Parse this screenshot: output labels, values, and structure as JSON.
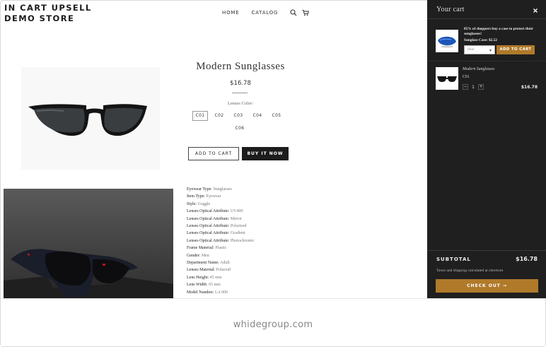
{
  "store": {
    "logo_line1": "IN CART UPSELL",
    "logo_line2": "DEMO STORE"
  },
  "nav": {
    "home": "HOME",
    "catalog": "CATALOG",
    "icons": [
      "search-icon",
      "cart-icon"
    ]
  },
  "product": {
    "title": "Modern Sunglasses",
    "price": "$16.78",
    "color_label": "Lenses Color:",
    "variants": [
      "C01",
      "C02",
      "C03",
      "C04",
      "C05",
      "C06"
    ],
    "selected_variant": "C01",
    "add_to_cart": "ADD TO CART",
    "buy_now": "BUY IT NOW"
  },
  "specs": [
    {
      "label": "Eyewear Type:",
      "value": "Sunglasses"
    },
    {
      "label": "Item Type:",
      "value": "Eyewear"
    },
    {
      "label": "Style:",
      "value": "Goggle"
    },
    {
      "label": "Lenses Optical Attribute:",
      "value": "UV400"
    },
    {
      "label": "Lenses Optical Attribute:",
      "value": "Mirror"
    },
    {
      "label": "Lenses Optical Attribute:",
      "value": "Polarized"
    },
    {
      "label": "Lenses Optical Attribute:",
      "value": "Gradient"
    },
    {
      "label": "Lenses Optical Attribute:",
      "value": "Photochromic"
    },
    {
      "label": "Frame Material:",
      "value": "Plastic"
    },
    {
      "label": "Gender:",
      "value": "Men"
    },
    {
      "label": "Department Name:",
      "value": "Adult"
    },
    {
      "label": "Lenses Material:",
      "value": "Polaroid"
    },
    {
      "label": "Lens Height:",
      "value": "45 mm"
    },
    {
      "label": "Lens Width:",
      "value": "65 mm"
    },
    {
      "label": "Model Number:",
      "value": "LA 006"
    }
  ],
  "cart": {
    "title": "Your cart",
    "upsell": {
      "text": "85% of shoppers buy a case to protect their sunglasses!",
      "name": "Sunglass Case: $2.52",
      "select_value": "blue",
      "add_button": "ADD TO CART"
    },
    "item": {
      "name": "Modern Sunglasses",
      "variant": "C01",
      "quantity": "1",
      "minus": "−",
      "plus": "+",
      "price": "$16.78"
    },
    "subtotal_label": "SUBTOTAL",
    "subtotal_value": "$16.78",
    "tax_note": "Taxes and shipping calculated at checkout",
    "checkout": "CHECK OUT →"
  },
  "watermark": "whidegroup.com",
  "colors": {
    "drawer_bg": "#1f1f1f",
    "accent": "#b07a2a",
    "buy_button": "#1c1c1c"
  }
}
